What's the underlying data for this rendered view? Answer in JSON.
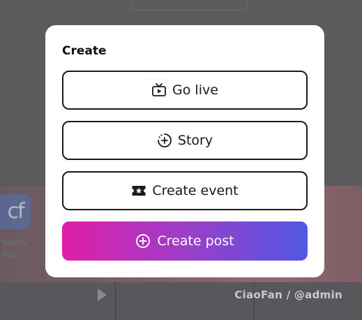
{
  "modal": {
    "title": "Create",
    "options": [
      {
        "label": "Go live",
        "icon": "live-tv-icon"
      },
      {
        "label": "Story",
        "icon": "story-add-icon"
      },
      {
        "label": "Create event",
        "icon": "ticket-icon"
      }
    ],
    "primary": {
      "label": "Create post",
      "icon": "plus-circle-icon"
    }
  },
  "background": {
    "logo_text": "cf",
    "meta_lines": [
      "SexCa",
      "Foto"
    ],
    "watermark": "CiaoFan / @admin"
  },
  "colors": {
    "primary_gradient_start": "#e01fa8",
    "primary_gradient_end": "#5058e4",
    "overlay": "#5b5b5e",
    "border": "#1a1a1a"
  }
}
